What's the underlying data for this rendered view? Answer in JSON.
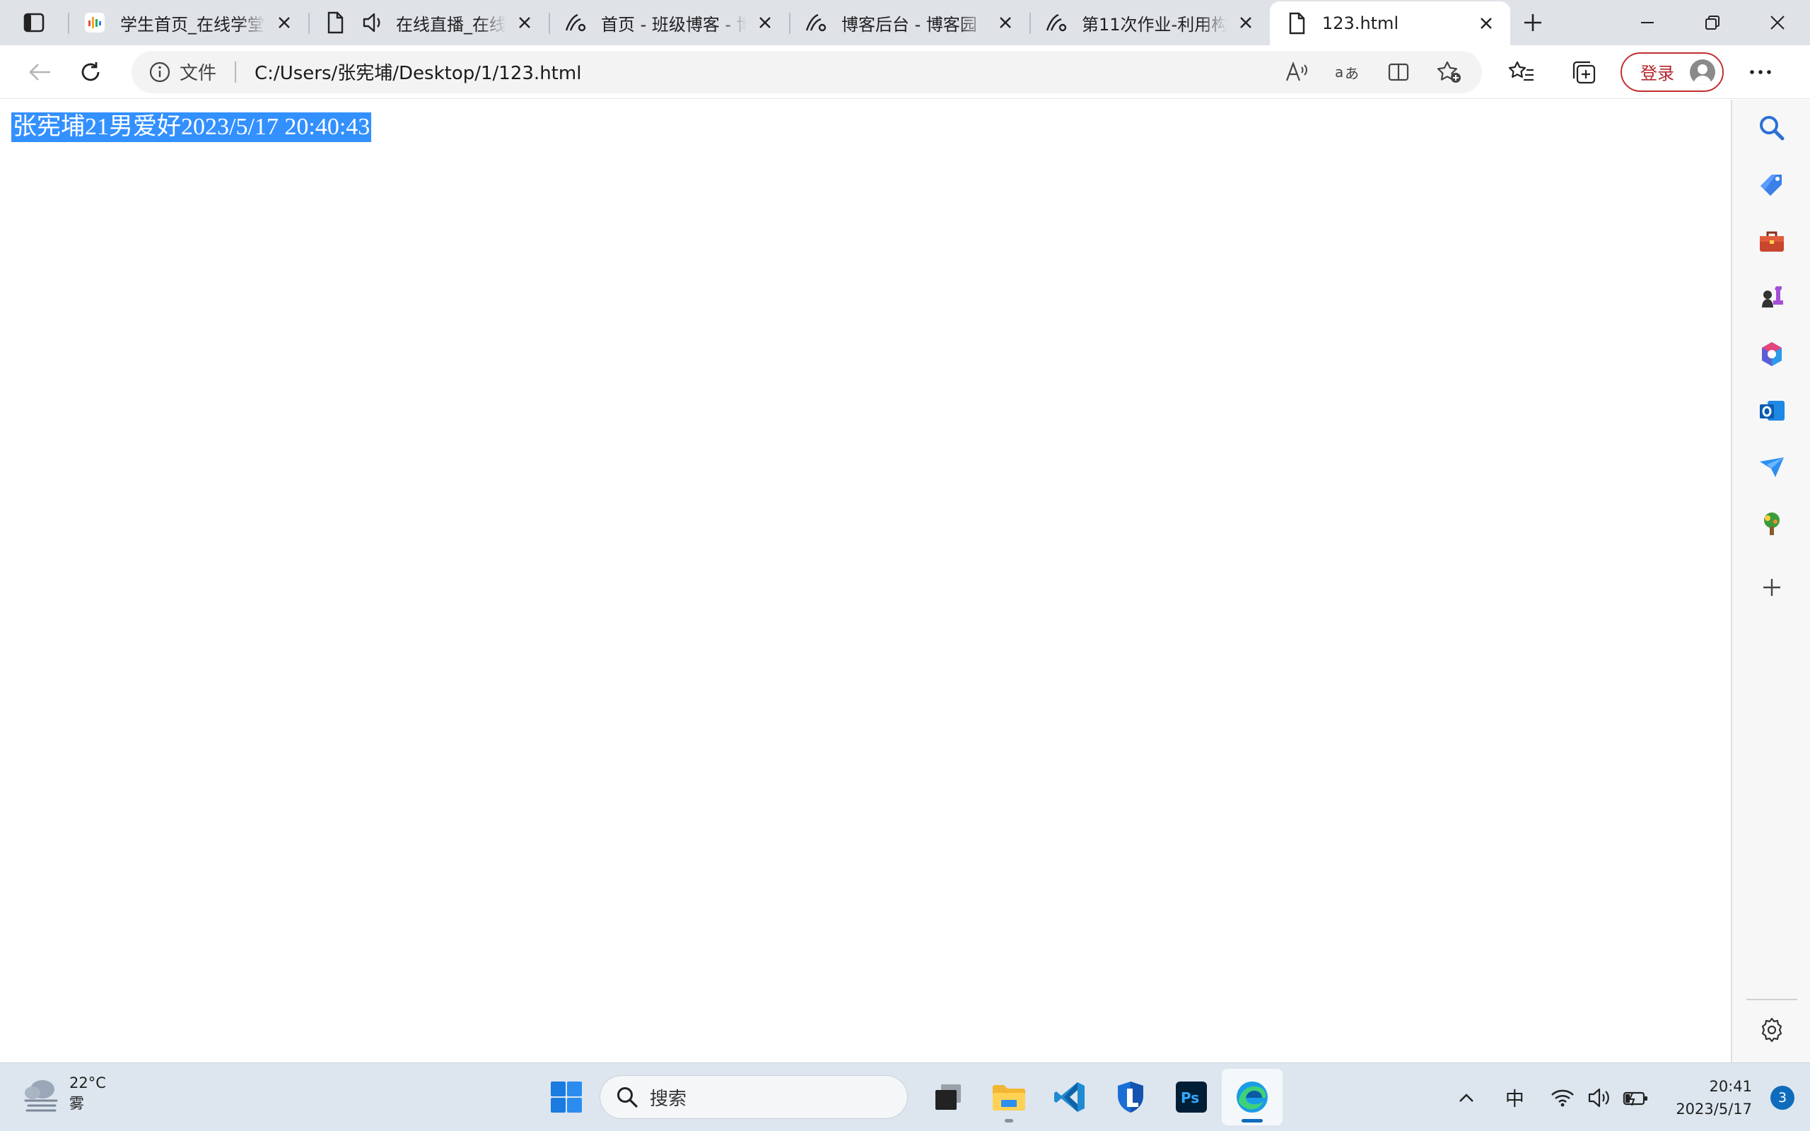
{
  "browser": {
    "tabs": [
      {
        "title": "学生首页_在线学堂",
        "favicon": "chart-favicon-icon",
        "active": false
      },
      {
        "title": "在线直播_在线",
        "favicon": "document-icon",
        "audio": true,
        "active": false
      },
      {
        "title": "首页 - 班级博客 - 博",
        "favicon": "cnblogs-icon",
        "active": false
      },
      {
        "title": "博客后台 - 博客园",
        "favicon": "cnblogs-icon",
        "active": false
      },
      {
        "title": "第11次作业-利用构",
        "favicon": "cnblogs-icon",
        "active": false
      },
      {
        "title": "123.html",
        "favicon": "document-icon",
        "active": true
      }
    ],
    "address": {
      "scheme_label": "文件",
      "url": "C:/Users/张宪埔/Desktop/1/123.html"
    },
    "signin_label": "登录"
  },
  "page": {
    "selected_text": "张宪埔21男爱好2023/5/17 20:40:43"
  },
  "taskbar": {
    "weather": {
      "temp": "22°C",
      "condition": "雾"
    },
    "search_placeholder": "搜索",
    "ime": "中",
    "time": "20:41",
    "date": "2023/5/17",
    "notifications": "3"
  },
  "colors": {
    "selection": "#3390ff",
    "signin_border": "#c22f2f",
    "accent": "#0f6cbd"
  }
}
